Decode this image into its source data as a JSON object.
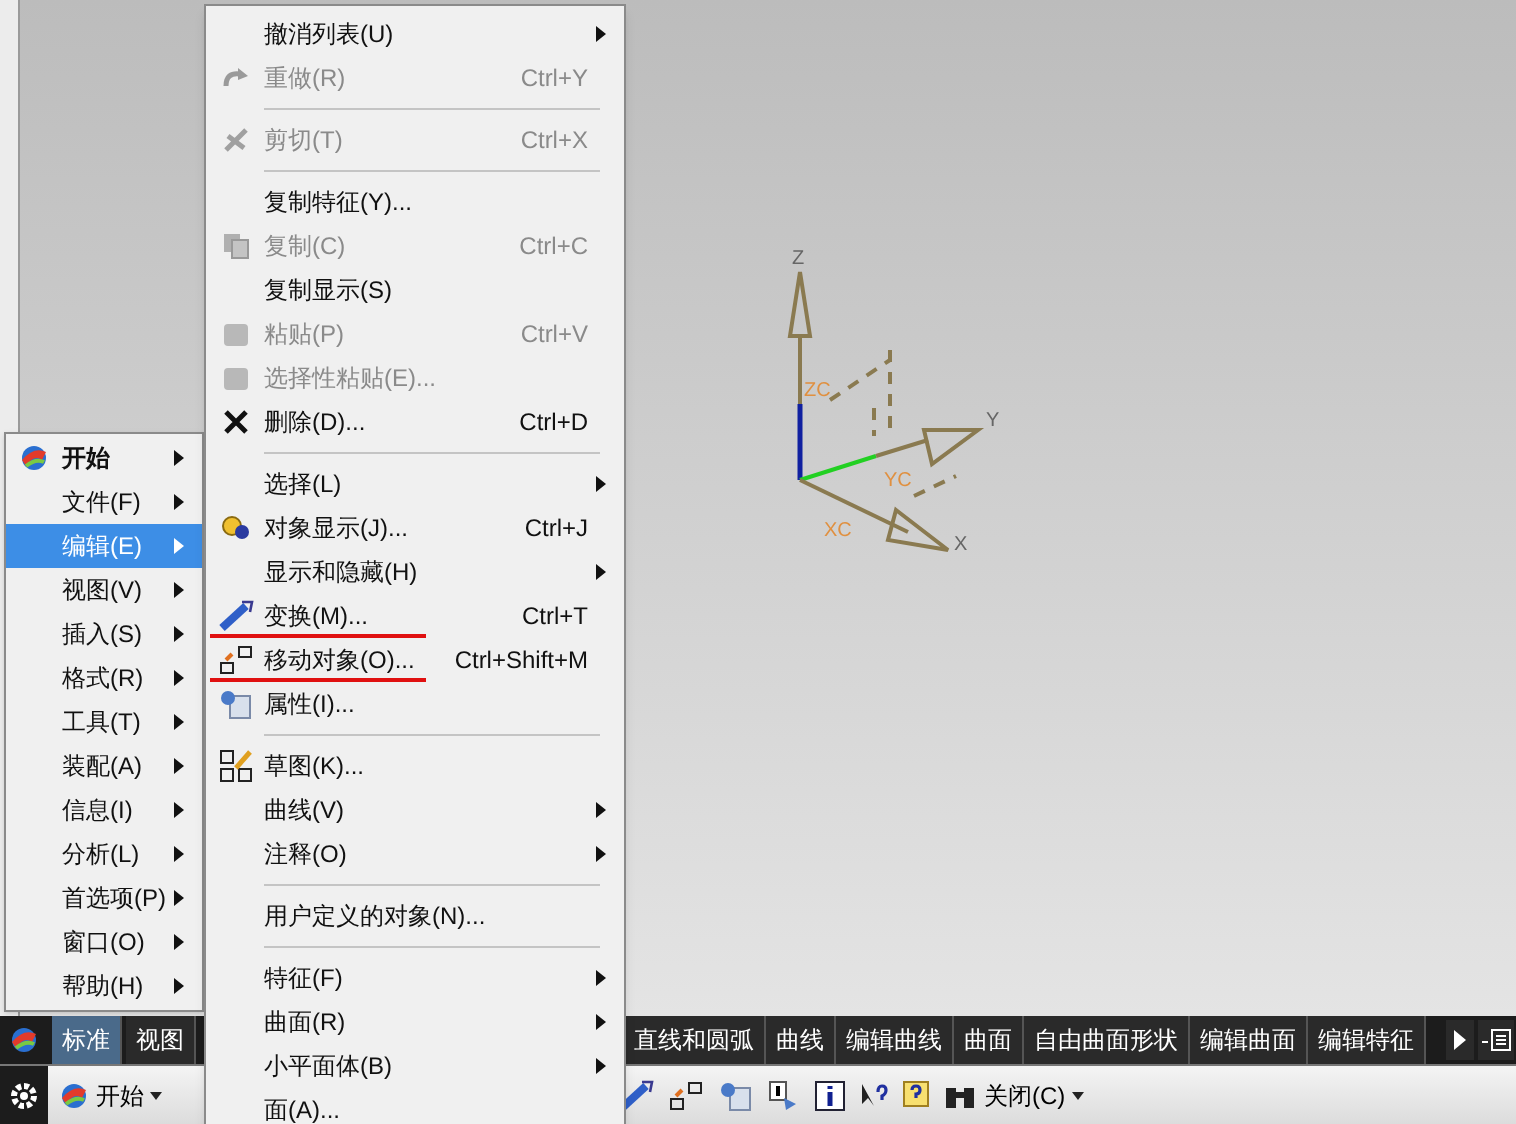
{
  "left_menu": [
    {
      "label": "开始",
      "selected": false,
      "bold": true,
      "kind": "logo"
    },
    {
      "label": "文件(F)",
      "selected": false
    },
    {
      "label": "编辑(E)",
      "selected": true
    },
    {
      "label": "视图(V)",
      "selected": false
    },
    {
      "label": "插入(S)",
      "selected": false
    },
    {
      "label": "格式(R)",
      "selected": false
    },
    {
      "label": "工具(T)",
      "selected": false
    },
    {
      "label": "装配(A)",
      "selected": false
    },
    {
      "label": "信息(I)",
      "selected": false
    },
    {
      "label": "分析(L)",
      "selected": false
    },
    {
      "label": "首选项(P)",
      "selected": false
    },
    {
      "label": "窗口(O)",
      "selected": false
    },
    {
      "label": "帮助(H)",
      "selected": false
    }
  ],
  "edit_menu": [
    {
      "kind": "item",
      "label": "撤消列表(U)",
      "submenu": true,
      "disabled": false
    },
    {
      "kind": "redo",
      "label": "重做(R)",
      "shortcut": "Ctrl+Y",
      "disabled": true
    },
    {
      "kind": "separator"
    },
    {
      "kind": "cut",
      "label": "剪切(T)",
      "shortcut": "Ctrl+X",
      "disabled": true
    },
    {
      "kind": "separator"
    },
    {
      "kind": "item",
      "label": "复制特征(Y)...",
      "disabled": false
    },
    {
      "kind": "copy",
      "label": "复制(C)",
      "shortcut": "Ctrl+C",
      "disabled": true
    },
    {
      "kind": "item",
      "label": "复制显示(S)",
      "disabled": false
    },
    {
      "kind": "paste",
      "label": "粘贴(P)",
      "shortcut": "Ctrl+V",
      "disabled": true
    },
    {
      "kind": "paste",
      "label": "选择性粘贴(E)...",
      "disabled": true
    },
    {
      "kind": "delete",
      "label": "删除(D)...",
      "shortcut": "Ctrl+D",
      "disabled": false
    },
    {
      "kind": "separator"
    },
    {
      "kind": "item",
      "label": "选择(L)",
      "submenu": true,
      "disabled": false
    },
    {
      "kind": "display",
      "label": "对象显示(J)...",
      "shortcut": "Ctrl+J",
      "disabled": false
    },
    {
      "kind": "item",
      "label": "显示和隐藏(H)",
      "submenu": true,
      "disabled": false
    },
    {
      "kind": "transform",
      "label": "变换(M)...",
      "shortcut": "Ctrl+T",
      "disabled": false,
      "marked": true
    },
    {
      "kind": "move",
      "label": "移动对象(O)...",
      "shortcut": "Ctrl+Shift+M",
      "disabled": false,
      "marked": true
    },
    {
      "kind": "property",
      "label": "属性(I)...",
      "disabled": false
    },
    {
      "kind": "separator"
    },
    {
      "kind": "sketch",
      "label": "草图(K)...",
      "disabled": false
    },
    {
      "kind": "item",
      "label": "曲线(V)",
      "submenu": true,
      "disabled": false
    },
    {
      "kind": "item",
      "label": "注释(O)",
      "submenu": true,
      "disabled": false
    },
    {
      "kind": "separator"
    },
    {
      "kind": "item",
      "label": "用户定义的对象(N)...",
      "disabled": false
    },
    {
      "kind": "separator"
    },
    {
      "kind": "item",
      "label": "特征(F)",
      "submenu": true,
      "disabled": false
    },
    {
      "kind": "item",
      "label": "曲面(R)",
      "submenu": true,
      "disabled": false
    },
    {
      "kind": "item",
      "label": "小平面体(B)",
      "submenu": true,
      "disabled": false
    },
    {
      "kind": "item",
      "label": "面(A)...",
      "disabled": false
    }
  ],
  "axis_labels": {
    "z": "Z",
    "zc": "ZC",
    "y": "Y",
    "yc": "YC",
    "x": "X",
    "xc": "XC"
  },
  "tab_bar": {
    "left_tabs": [
      {
        "label": "标准",
        "selected": true
      },
      {
        "label": "视图",
        "selected": false
      }
    ],
    "right_tabs": [
      {
        "label": "直线和圆弧",
        "selected": false
      },
      {
        "label": "曲线",
        "selected": false
      },
      {
        "label": "编辑曲线",
        "selected": false
      },
      {
        "label": "曲面",
        "selected": false
      },
      {
        "label": "自由曲面形状",
        "selected": false
      },
      {
        "label": "编辑曲面",
        "selected": false
      },
      {
        "label": "编辑特征",
        "selected": false
      }
    ]
  },
  "toolbar": {
    "start_button": "开始",
    "close_button": "关闭(C)"
  }
}
